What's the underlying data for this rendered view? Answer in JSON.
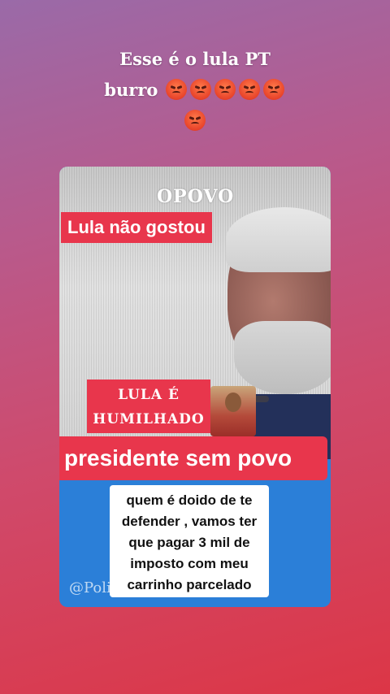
{
  "caption": {
    "line1": "Esse é o lula PT",
    "line2": "burro",
    "emoji_icon": "angry-face-emoji"
  },
  "video": {
    "logo": "OPOVO",
    "badge_top": "Lula não gostou",
    "badge_humiliated_line1": "LULA É",
    "badge_humiliated_line2": "HUMILHADO",
    "banner": "presidente sem povo",
    "watermark": "@Poli"
  },
  "comment": {
    "text": "quem é doido de te defender , vamos ter que pagar 3 mil de imposto com meu carrinho parcelado"
  },
  "colors": {
    "badge_red": "#e8364c",
    "card_blue": "#2b7fd8",
    "background_top": "#9a6aa8",
    "background_bottom": "#dc3646"
  }
}
